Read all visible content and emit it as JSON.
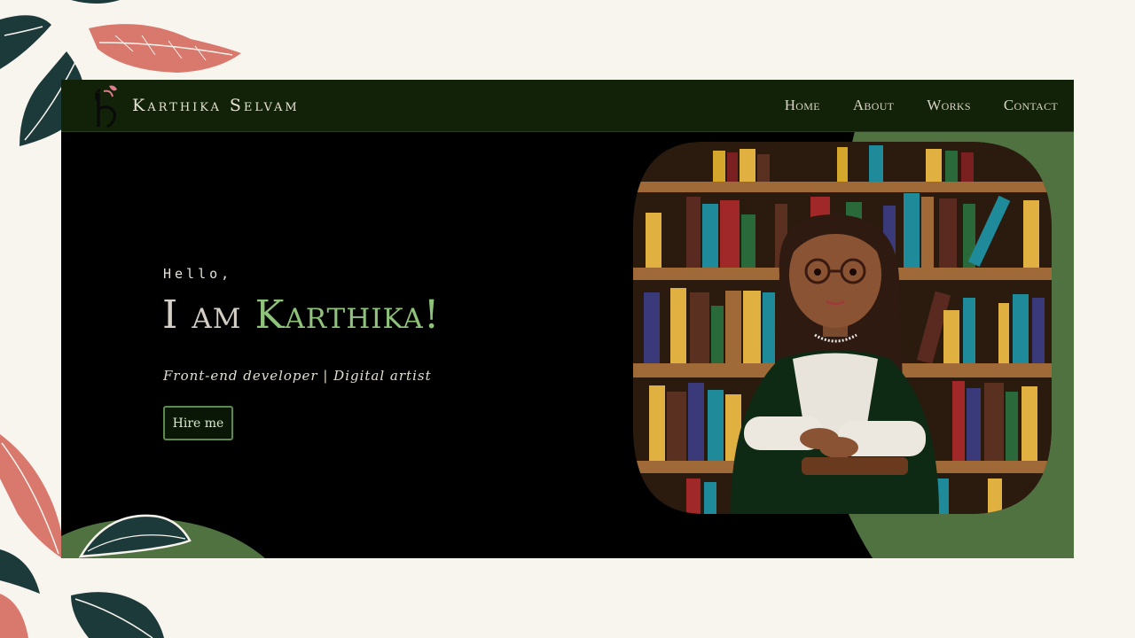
{
  "brand": {
    "name": "Karthika Selvam",
    "logo_letter": "K"
  },
  "nav": {
    "items": [
      {
        "label": "Home"
      },
      {
        "label": "About"
      },
      {
        "label": "Works"
      },
      {
        "label": "Contact"
      }
    ]
  },
  "hero": {
    "greeting": "Hello,",
    "intro": "I am ",
    "name": "Karthika!",
    "tagline": "Front-end developer | Digital artist",
    "cta_label": "Hire me"
  },
  "colors": {
    "page_background": "#f8f4ee",
    "nav_background": "#112208",
    "accent_green": "#8fc27a",
    "blob_green": "#4f7240",
    "coral_leaf": "#d9786c",
    "dark_leaf": "#1d3a3a"
  },
  "icons": [
    "logo-icon",
    "leaf-icon"
  ]
}
